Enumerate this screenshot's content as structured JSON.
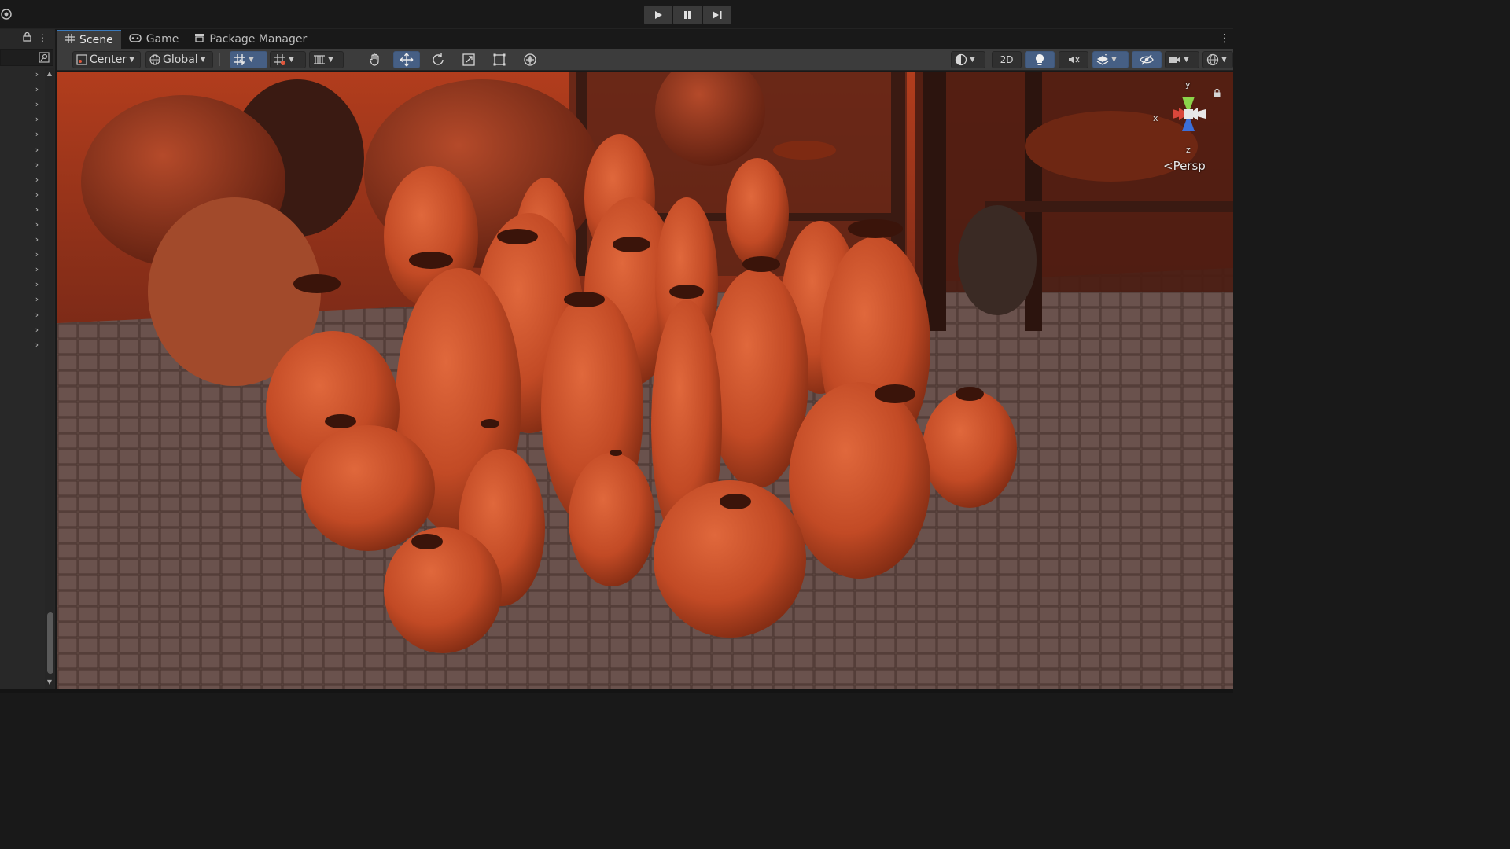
{
  "tabs": [
    {
      "label": "Scene",
      "icon": "grid-icon"
    },
    {
      "label": "Game",
      "icon": "gamepad-icon"
    },
    {
      "label": "Package Manager",
      "icon": "package-icon"
    }
  ],
  "toolbar": {
    "pivot_mode": "Center",
    "pivot_rotation": "Global",
    "toggle_2d": "2D"
  },
  "gizmo": {
    "projection": "Persp",
    "axis_y": "y",
    "axis_x": "x",
    "axis_z": "z"
  },
  "colors": {
    "accent": "#3a79bb",
    "active_button": "#465f84",
    "gizmo_x": "#d9473b",
    "gizmo_y": "#8bd44b",
    "gizmo_z": "#3b6fd9",
    "pottery": "#c24a25"
  }
}
